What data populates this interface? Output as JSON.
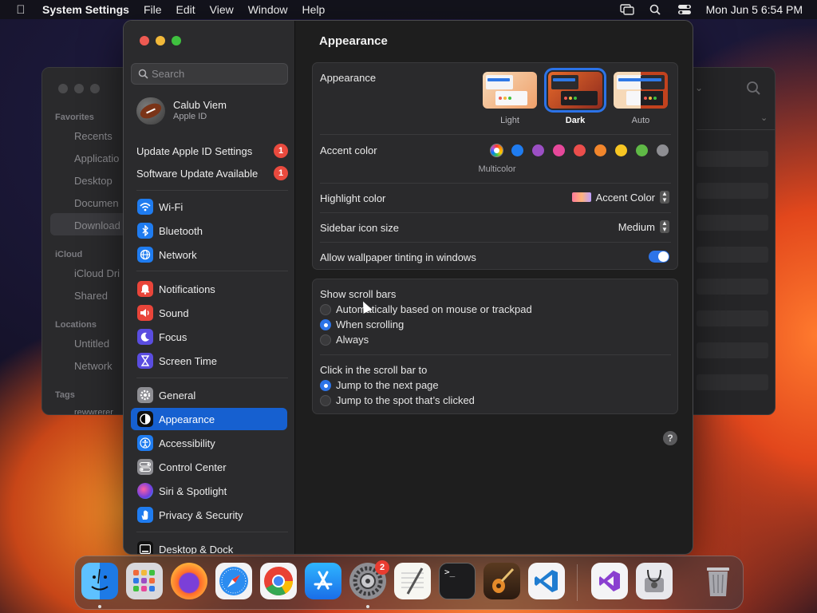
{
  "menubar": {
    "app_name": "System Settings",
    "menus": [
      "File",
      "Edit",
      "View",
      "Window",
      "Help"
    ],
    "clock": "Mon Jun 5  6:54 PM"
  },
  "finder": {
    "sections": [
      "Favorites",
      "iCloud",
      "Locations",
      "Tags"
    ],
    "items": [
      "Recents",
      "Applicatio",
      "Desktop",
      "Documen",
      "Download",
      "iCloud Dri",
      "Shared",
      "Untitled",
      "Network",
      "rewwrerer"
    ]
  },
  "sidebar": {
    "search_placeholder": "Search",
    "account": {
      "name": "Calub Viem",
      "subtitle": "Apple ID"
    },
    "notices": [
      {
        "label": "Update Apple ID Settings",
        "badge": "1"
      },
      {
        "label": "Software Update Available",
        "badge": "1"
      }
    ],
    "items": [
      {
        "label": "Wi-Fi",
        "icon": "wifi-icon",
        "color": "#1f7cf0"
      },
      {
        "label": "Bluetooth",
        "icon": "bluetooth-icon",
        "color": "#1f7cf0"
      },
      {
        "label": "Network",
        "icon": "network-icon",
        "color": "#1f7cf0"
      },
      {
        "label": "Notifications",
        "icon": "bell-icon",
        "color": "#e9453a"
      },
      {
        "label": "Sound",
        "icon": "speaker-icon",
        "color": "#e9453a"
      },
      {
        "label": "Focus",
        "icon": "moon-icon",
        "color": "#5a4de0"
      },
      {
        "label": "Screen Time",
        "icon": "hourglass-icon",
        "color": "#5a4de0"
      },
      {
        "label": "General",
        "icon": "gear-icon",
        "color": "#8e8e93"
      },
      {
        "label": "Appearance",
        "icon": "appearance-icon",
        "color": "#111111"
      },
      {
        "label": "Accessibility",
        "icon": "accessibility-icon",
        "color": "#1f7cf0"
      },
      {
        "label": "Control Center",
        "icon": "toggles-icon",
        "color": "#8e8e93"
      },
      {
        "label": "Siri & Spotlight",
        "icon": "siri-icon",
        "color": "#8a3fd0"
      },
      {
        "label": "Privacy & Security",
        "icon": "hand-icon",
        "color": "#1f7cf0"
      },
      {
        "label": "Desktop & Dock",
        "icon": "dock-icon",
        "color": "#111111"
      }
    ],
    "selected": "Appearance"
  },
  "main": {
    "title": "Appearance",
    "appearance": {
      "label": "Appearance",
      "options": [
        "Light",
        "Dark",
        "Auto"
      ],
      "selected": "Dark"
    },
    "accent": {
      "label": "Accent color",
      "colors": [
        "#1f7cf0",
        "#9b4fc4",
        "#e6489a",
        "#eb4e4c",
        "#f2862c",
        "#f8c623",
        "#5fb946",
        "#8e8e93"
      ],
      "selected_name": "Multicolor"
    },
    "highlight": {
      "label": "Highlight color",
      "value": "Accent Color"
    },
    "icon_size": {
      "label": "Sidebar icon size",
      "value": "Medium"
    },
    "tinting": {
      "label": "Allow wallpaper tinting in windows",
      "on": true
    },
    "scroll_bars": {
      "label": "Show scroll bars",
      "options": [
        "Automatically based on mouse or trackpad",
        "When scrolling",
        "Always"
      ],
      "selected": "When scrolling"
    },
    "click_scroll": {
      "label": "Click in the scroll bar to",
      "options": [
        "Jump to the next page",
        "Jump to the spot that’s clicked"
      ],
      "selected": "Jump to the next page"
    },
    "help": "?"
  },
  "dock": {
    "apps": [
      "Finder",
      "Launchpad",
      "Firefox",
      "Safari",
      "Chrome",
      "App Store",
      "System Settings",
      "TextEdit",
      "Terminal",
      "GarageBand",
      "VS Code",
      "Visual Studio",
      "Disk Utility",
      "Trash"
    ],
    "settings_badge": "2"
  }
}
